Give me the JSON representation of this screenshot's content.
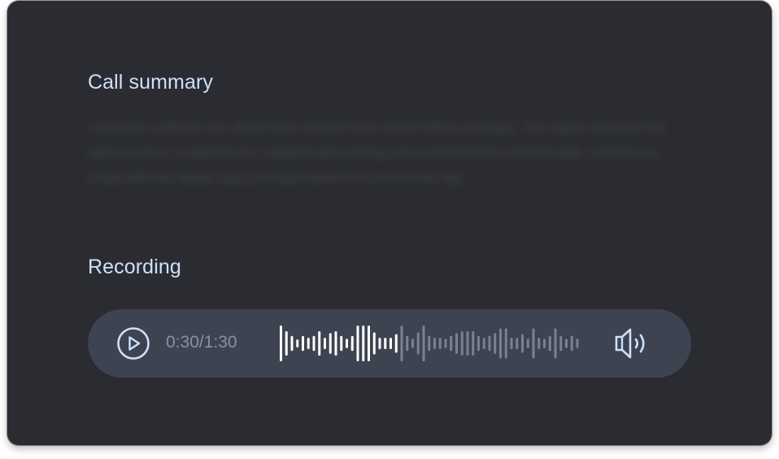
{
  "summary": {
    "title": "Call summary",
    "text": "Customer called to ask about their account and recent billing changes. The agent reviewed the latest invoice, explained the updated plan pricing and confirmed the renewal date. A follow-up email with the details was promised before the end of the day."
  },
  "recording": {
    "title": "Recording",
    "time_display": "0:30/1:30",
    "current_time": "0:30",
    "duration": "1:30",
    "progress": 0.333,
    "icons": {
      "play": "play-circle-icon",
      "volume": "speaker-volume-icon"
    },
    "waveform_levels": [
      1.0,
      0.68,
      0.42,
      0.22,
      0.42,
      0.32,
      0.42,
      0.68,
      0.32,
      0.58,
      0.68,
      0.42,
      0.26,
      0.42,
      1.0,
      1.0,
      1.0,
      0.62,
      0.32,
      0.32,
      0.32,
      0.52,
      1.0,
      0.42,
      0.26,
      0.62,
      1.0,
      0.42,
      0.32,
      0.32,
      0.26,
      0.42,
      0.58,
      0.68,
      0.68,
      0.68,
      0.42,
      0.32,
      0.42,
      0.58,
      0.84,
      0.84,
      0.32,
      0.32,
      0.52,
      0.26,
      0.84,
      0.32,
      0.26,
      0.42,
      0.84,
      0.42,
      0.26,
      0.42,
      0.26
    ],
    "colors": {
      "played": "#ffffff",
      "unplayed": "#7a8190",
      "accent": "#cfe0fb"
    }
  }
}
